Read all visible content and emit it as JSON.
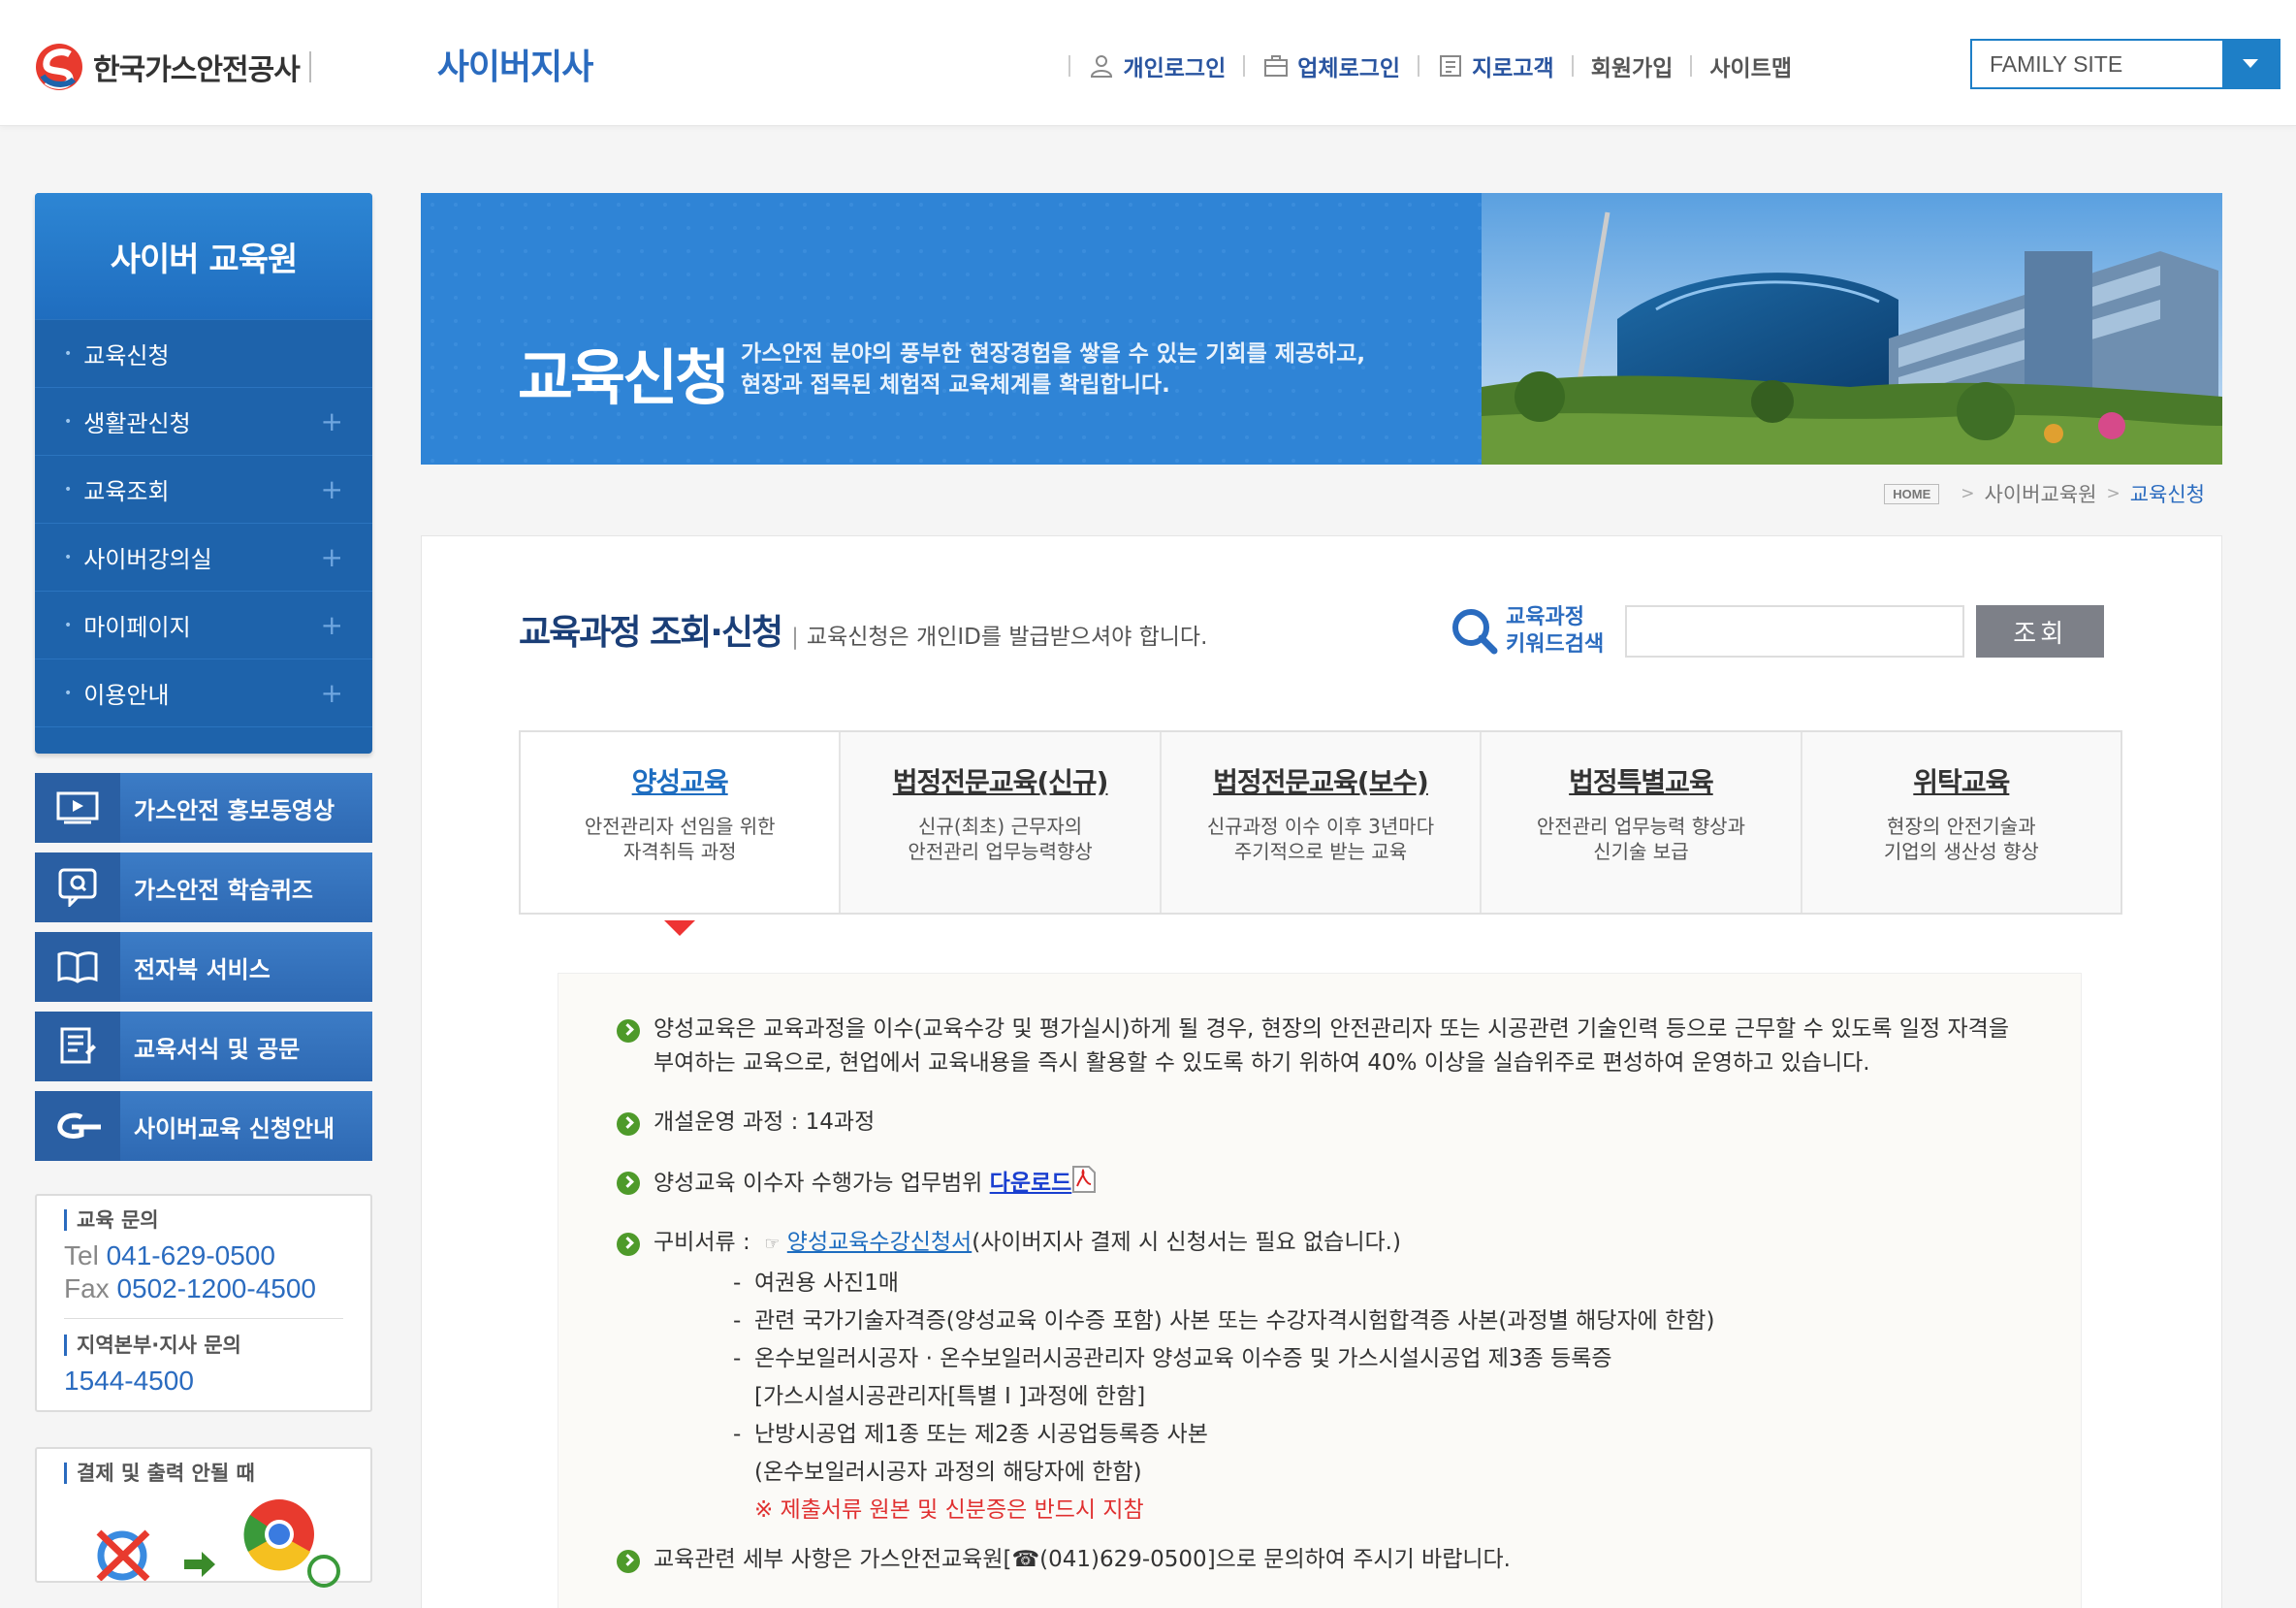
{
  "header": {
    "org_name": "한국가스안전공사",
    "site_name": "사이버지사",
    "nav": [
      {
        "label": "개인로그인"
      },
      {
        "label": "업체로그인"
      },
      {
        "label": "지로고객"
      },
      {
        "label": "회원가입"
      },
      {
        "label": "사이트맵"
      }
    ],
    "family_site": "FAMILY SITE"
  },
  "sidebar": {
    "title": "사이버 교육원",
    "menu": [
      {
        "label": "교육신청"
      },
      {
        "label": "생활관신청"
      },
      {
        "label": "교육조회"
      },
      {
        "label": "사이버강의실"
      },
      {
        "label": "마이페이지"
      },
      {
        "label": "이용안내"
      }
    ],
    "quick": [
      {
        "label": "가스안전 홍보동영상",
        "icon": "video-icon"
      },
      {
        "label": "가스안전 학습퀴즈",
        "icon": "quiz-icon"
      },
      {
        "label": "전자북 서비스",
        "icon": "book-icon"
      },
      {
        "label": "교육서식 및 공문",
        "icon": "document-icon"
      },
      {
        "label": "사이버교육 신청안내",
        "icon": "g-logo-icon"
      }
    ],
    "contact": {
      "edu_title": "교육 문의",
      "tel_label": "Tel",
      "tel": "041-629-0500",
      "fax_label": "Fax",
      "fax": "0502-1200-4500",
      "region_title": "지역본부·지사 문의",
      "region_tel": "1544-4500"
    },
    "print_help": {
      "title": "결제 및 출력 안될 때"
    }
  },
  "banner": {
    "title": "교육신청",
    "desc_line1": "가스안전 분야의 풍부한 현장경험을 쌓을 수 있는 기회를 제공하고,",
    "desc_line2": "현장과 접목된 체험적 교육체계를 확립합니다."
  },
  "breadcrumb": {
    "home": "HOME",
    "level1": "사이버교육원",
    "current": "교육신청"
  },
  "section": {
    "title": "교육과정 조회·신청",
    "note": "교육신청은 개인ID를 발급받으셔야 합니다.",
    "kw_label1": "교육과정",
    "kw_label2": "키워드검색",
    "kw_value": "",
    "search_btn": "조회"
  },
  "tabs": [
    {
      "name": "양성교육",
      "desc1": "안전관리자 선임을 위한",
      "desc2": "자격취득 과정",
      "active": true
    },
    {
      "name": "법정전문교육(신규)",
      "desc1": "신규(최초) 근무자의",
      "desc2": "안전관리 업무능력향상",
      "active": false
    },
    {
      "name": "법정전문교육(보수)",
      "desc1": "신규과정 이수 이후 3년마다",
      "desc2": "주기적으로 받는 교육",
      "active": false
    },
    {
      "name": "법정특별교육",
      "desc1": "안전관리 업무능력 향상과",
      "desc2": "신기술 보급",
      "active": false
    },
    {
      "name": "위탁교육",
      "desc1": "현장의 안전기술과",
      "desc2": "기업의 생산성 향상",
      "active": false
    }
  ],
  "detail": {
    "p1": "양성교육은 교육과정을 이수(교육수강 및 평가실시)하게 될 경우, 현장의 안전관리자 또는 시공관련 기술인력 등으로 근무할 수 있도록 일정 자격을 부여하는 교육으로, 현업에서 교육내용을 즉시 활용할 수 있도록 하기 위하여 40% 이상을 실습위주로 편성하여 운영하고 있습니다.",
    "p2": "개설운영 과정 : 14과정",
    "p3_text": "양성교육 이수자 수행가능 업무범위",
    "p3_link": "다운로드",
    "p4_label": "구비서류 :",
    "p4_link": "양성교육수강신청서",
    "p4_rest": "(사이버지사 결제 시 신청서는 필요 없습니다.)",
    "docs": [
      "여권용 사진1매",
      "관련 국가기술자격증(양성교육 이수증 포함) 사본 또는 수강자격시험합격증 사본(과정별 해당자에 한함)",
      "온수보일러시공자 · 온수보일러시공관리자 양성교육 이수증 및 가스시설시공업 제3종 등록증",
      "난방시공업 제1종 또는 제2종 시공업등록증 사본"
    ],
    "doc3_cont": "[가스시설시공관리자[특별 I ]과정에 한함]",
    "doc4_cont": "(온수보일러시공자 과정의 해당자에 한함)",
    "warning": "※ 제출서류 원본 및 신분증은 반드시 지참",
    "p5": "교육관련 세부 사항은 가스안전교육원[☎(041)629-0500]으로 문의하여 주시기 바랍니다."
  }
}
